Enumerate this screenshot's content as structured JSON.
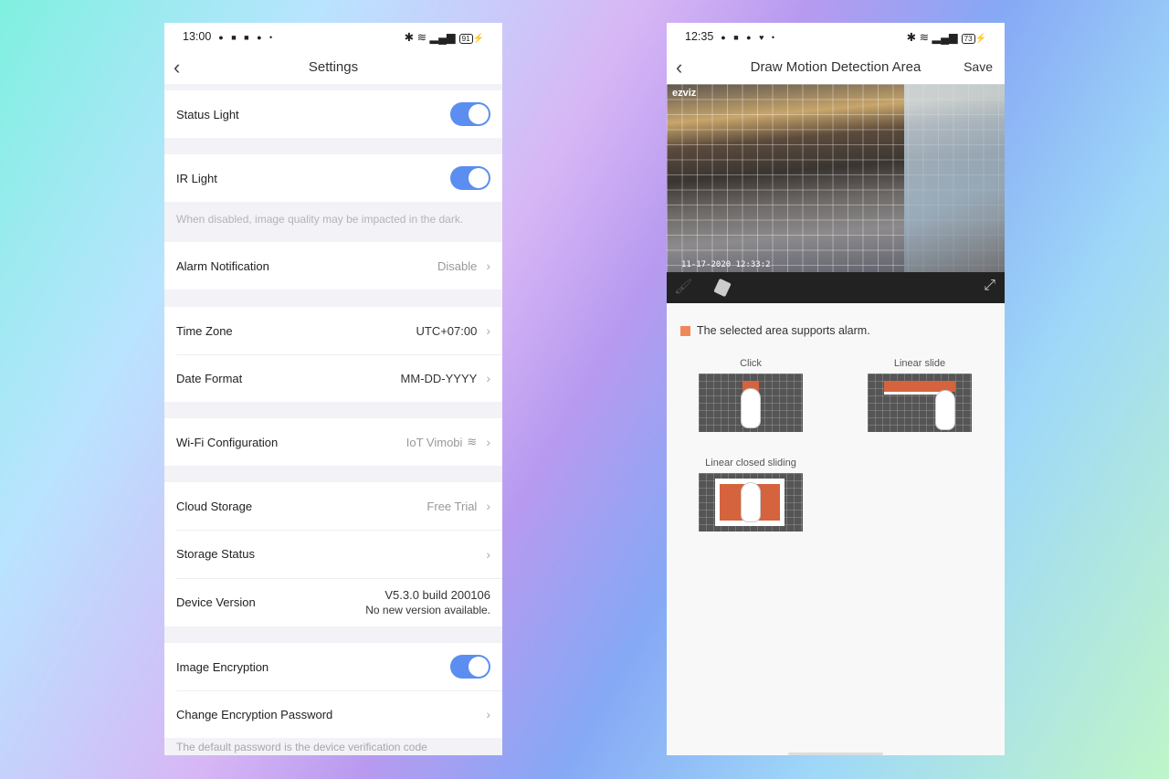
{
  "left": {
    "status": {
      "time": "13:00",
      "battery": "91"
    },
    "title": "Settings",
    "rows": {
      "status_light": {
        "label": "Status Light",
        "on": true
      },
      "ir_light": {
        "label": "IR Light",
        "on": true,
        "hint": "When disabled, image quality may be impacted in the dark."
      },
      "alarm": {
        "label": "Alarm Notification",
        "value": "Disable"
      },
      "time_zone": {
        "label": "Time Zone",
        "value": "UTC+07:00"
      },
      "date_format": {
        "label": "Date Format",
        "value": "MM-DD-YYYY"
      },
      "wifi": {
        "label": "Wi-Fi Configuration",
        "value": "IoT Vimobi"
      },
      "cloud": {
        "label": "Cloud Storage",
        "value": "Free Trial"
      },
      "storage": {
        "label": "Storage Status"
      },
      "version": {
        "label": "Device Version",
        "value": "V5.3.0 build 200106",
        "sub": "No new version available."
      },
      "encryption": {
        "label": "Image Encryption",
        "on": true
      },
      "change_pw": {
        "label": "Change Encryption Password"
      },
      "footer": "The default password is the device verification code"
    }
  },
  "right": {
    "status": {
      "time": "12:35",
      "battery": "73"
    },
    "title": "Draw Motion Detection Area",
    "save": "Save",
    "camera": {
      "logo": "ezviz",
      "timestamp": "11-17-2020 12:33:2"
    },
    "legend": "The selected area supports alarm.",
    "legend_color": "#f0875a",
    "demos": [
      "Click",
      "Linear slide",
      "Linear closed sliding"
    ]
  }
}
